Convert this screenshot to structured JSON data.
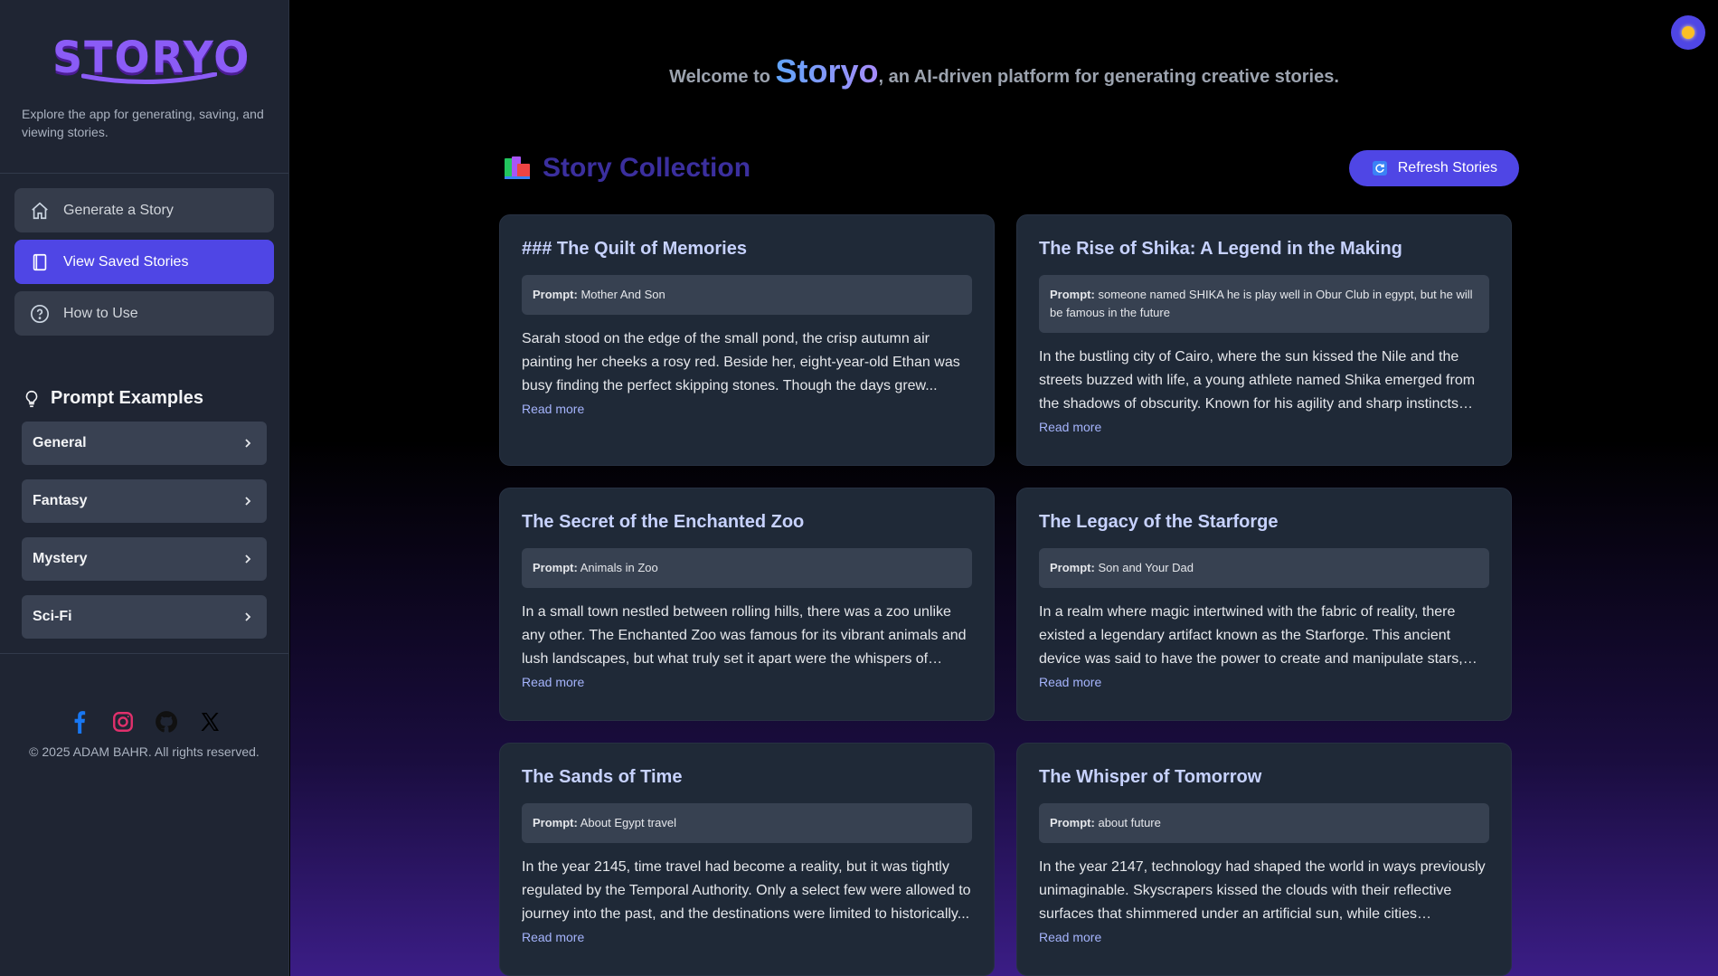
{
  "sidebar": {
    "logo_text": "STORYO",
    "tagline": "Explore the app for generating, saving, and viewing stories.",
    "nav": [
      {
        "label": "Generate a Story",
        "icon": "home-icon",
        "active": false
      },
      {
        "label": "View Saved Stories",
        "icon": "book-icon",
        "active": true
      },
      {
        "label": "How to Use",
        "icon": "help-circle-icon",
        "active": false
      }
    ],
    "examples_title": "Prompt Examples",
    "examples": [
      "General",
      "Fantasy",
      "Mystery",
      "Sci-Fi"
    ],
    "socials": [
      "facebook-icon",
      "instagram-icon",
      "github-icon",
      "x-icon"
    ],
    "copyright": "© 2025 ADAM BAHR. All rights reserved."
  },
  "header": {
    "welcome_prefix": "Welcome to",
    "brand": "Storyo",
    "welcome_suffix": ", an AI-driven platform for generating creative stories."
  },
  "collection": {
    "title": "Story Collection",
    "refresh_label": "Refresh Stories"
  },
  "stories": [
    {
      "title": "### The Quilt of Memories",
      "prompt_label": "Prompt:",
      "prompt": "Mother And Son",
      "excerpt": "Sarah stood on the edge of the small pond, the crisp autumn air painting her cheeks a rosy red. Beside her, eight-year-old Ethan was busy finding the perfect skipping stones. Though the days grew...",
      "read_more": "Read more"
    },
    {
      "title": "The Rise of Shika: A Legend in the Making",
      "prompt_label": "Prompt:",
      "prompt": "someone named SHIKA he is play well in Obur Club in egypt, but he will be famous in the future",
      "excerpt": "In the bustling city of Cairo, where the sun kissed the Nile and the streets buzzed with life, a young athlete named Shika emerged from the shadows of obscurity. Known for his agility and sharp instincts on...",
      "read_more": "Read more"
    },
    {
      "title": "The Secret of the Enchanted Zoo",
      "prompt_label": "Prompt:",
      "prompt": "Animals in Zoo",
      "excerpt": "In a small town nestled between rolling hills, there was a zoo unlike any other. The Enchanted Zoo was famous for its vibrant animals and lush landscapes, but what truly set it apart were the whispers of magi...",
      "read_more": "Read more"
    },
    {
      "title": "The Legacy of the Starforge",
      "prompt_label": "Prompt:",
      "prompt": "Son and Your Dad",
      "excerpt": "In a realm where magic intertwined with the fabric of reality, there existed a legendary artifact known as the Starforge. This ancient device was said to have the power to create and manipulate stars, granting...",
      "read_more": "Read more"
    },
    {
      "title": "The Sands of Time",
      "prompt_label": "Prompt:",
      "prompt": "About Egypt travel",
      "excerpt": "In the year 2145, time travel had become a reality, but it was tightly regulated by the Temporal Authority. Only a select few were allowed to journey into the past, and the destinations were limited to historically...",
      "read_more": "Read more"
    },
    {
      "title": "The Whisper of Tomorrow",
      "prompt_label": "Prompt:",
      "prompt": "about future",
      "excerpt": "In the year 2147, technology had shaped the world in ways previously unimaginable. Skyscrapers kissed the clouds with their reflective surfaces that shimmered under an artificial sun, while cities thrumme...",
      "read_more": "Read more"
    }
  ],
  "colors": {
    "accent": "#4f46e5",
    "sidebar_bg": "#1f2533",
    "card_bg": "#1f2937",
    "card_title": "#c7d2fe"
  }
}
